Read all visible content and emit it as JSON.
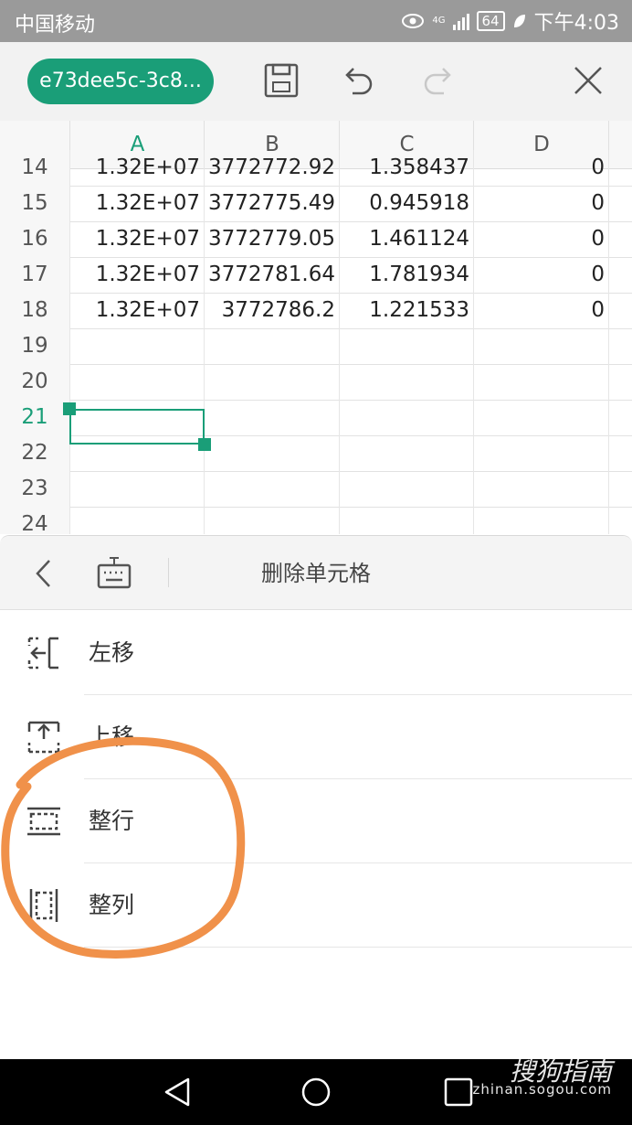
{
  "status_bar": {
    "carrier": "中国移动",
    "network": "4G",
    "battery": "64",
    "time": "下午4:03"
  },
  "toolbar": {
    "file_name": "e73dee5c-3c8...",
    "icons": [
      "save-icon",
      "undo-icon",
      "redo-icon",
      "close-icon"
    ]
  },
  "sheet": {
    "columns": [
      "A",
      "B",
      "C",
      "D"
    ],
    "active_column": "A",
    "active_row": "21",
    "rows": [
      {
        "num": "14",
        "a": "1.32E+07",
        "b": "3772772.92",
        "c": "1.358437",
        "d": "0"
      },
      {
        "num": "15",
        "a": "1.32E+07",
        "b": "3772775.49",
        "c": "0.945918",
        "d": "0"
      },
      {
        "num": "16",
        "a": "1.32E+07",
        "b": "3772779.05",
        "c": "1.461124",
        "d": "0"
      },
      {
        "num": "17",
        "a": "1.32E+07",
        "b": "3772781.64",
        "c": "1.781934",
        "d": "0"
      },
      {
        "num": "18",
        "a": "1.32E+07",
        "b": "3772786.2",
        "c": "1.221533",
        "d": "0"
      },
      {
        "num": "19",
        "a": "",
        "b": "",
        "c": "",
        "d": ""
      },
      {
        "num": "20",
        "a": "",
        "b": "",
        "c": "",
        "d": ""
      },
      {
        "num": "21",
        "a": "",
        "b": "",
        "c": "",
        "d": ""
      },
      {
        "num": "22",
        "a": "",
        "b": "",
        "c": "",
        "d": ""
      },
      {
        "num": "23",
        "a": "",
        "b": "",
        "c": "",
        "d": ""
      },
      {
        "num": "24",
        "a": "",
        "b": "",
        "c": "",
        "d": ""
      }
    ]
  },
  "panel": {
    "title": "删除单元格",
    "options": [
      {
        "label": "左移",
        "icon": "shift-left-icon"
      },
      {
        "label": "上移",
        "icon": "shift-up-icon"
      },
      {
        "label": "整行",
        "icon": "entire-row-icon"
      },
      {
        "label": "整列",
        "icon": "entire-column-icon"
      }
    ]
  },
  "colors": {
    "accent": "#1a9e78",
    "annotation": "#f0914a",
    "status_bar": "#9a9a9a"
  },
  "watermark": {
    "brand": "搜狗指南",
    "url": "zhinan.sogou.com"
  }
}
